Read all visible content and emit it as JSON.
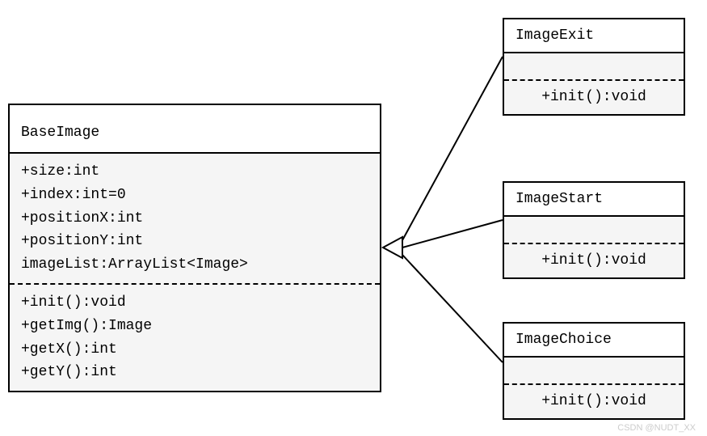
{
  "baseImage": {
    "name": "BaseImage",
    "attributes": {
      "a0": "+size:int",
      "a1": "+index:int=0",
      "a2": "+positionX:int",
      "a3": "+positionY:int",
      "a4": "imageList:ArrayList<Image>"
    },
    "methods": {
      "m0": "+init():void",
      "m1": "+getImg():Image",
      "m2": "+getX():int",
      "m3": "+getY():int"
    }
  },
  "imageExit": {
    "name": "ImageExit",
    "method": "+init():void"
  },
  "imageStart": {
    "name": "ImageStart",
    "method": "+init():void"
  },
  "imageChoice": {
    "name": "ImageChoice",
    "method": "+init():void"
  },
  "watermark": "CSDN @NUDT_XX"
}
